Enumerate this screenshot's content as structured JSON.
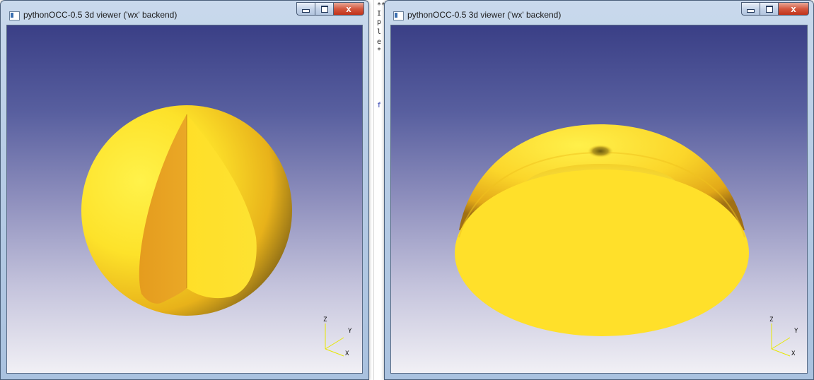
{
  "background_editor": {
    "lines": [
      "*******",
      "I",
      "p",
      "l",
      "e",
      "*",
      "f"
    ]
  },
  "windows": [
    {
      "title": "pythonOCC-0.5 3d viewer ('wx' backend)",
      "buttons": {
        "minimize": "",
        "maximize": "",
        "close": "x"
      },
      "view": "sphere with removed wedge"
    },
    {
      "title": "pythonOCC-0.5 3d viewer ('wx' backend)",
      "buttons": {
        "minimize": "",
        "maximize": "",
        "close": "x"
      },
      "view": "hemisphere shell"
    }
  ],
  "triedron": {
    "z": "Z",
    "y": "Y",
    "x": "X"
  },
  "colors": {
    "shape_light": "#ffe22a",
    "shape_dark": "#e8a622",
    "axis_yellow": "#e7e700"
  }
}
